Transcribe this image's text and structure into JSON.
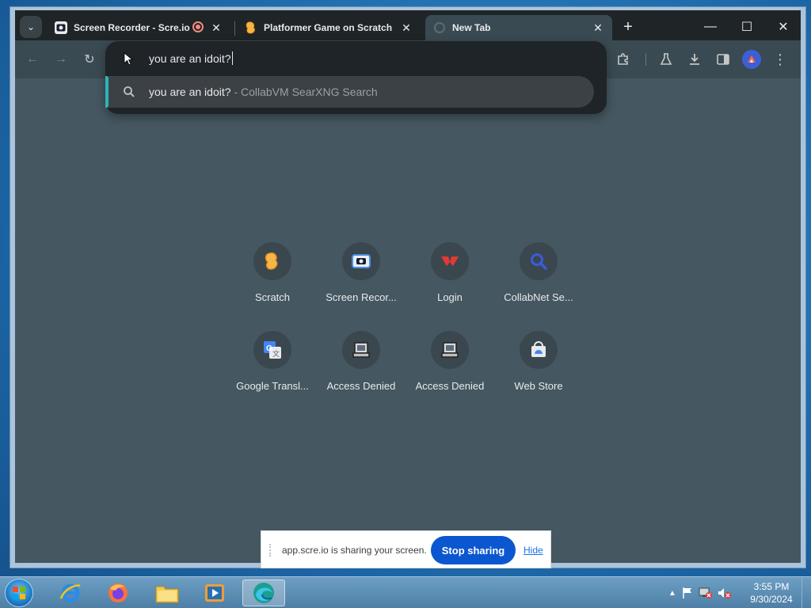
{
  "browser": {
    "tabs": [
      {
        "label": "Screen Recorder - Scre.io",
        "icon": "screen-recorder-icon",
        "recording": true,
        "active": false
      },
      {
        "label": "Platformer Game on Scratch",
        "icon": "scratch-icon",
        "recording": false,
        "active": false
      },
      {
        "label": "New Tab",
        "icon": "new-tab-icon",
        "recording": false,
        "active": true
      }
    ],
    "tab_close_glyph": "✕",
    "new_tab_glyph": "+",
    "window_controls": {
      "minimize": "—",
      "maximize": "☐",
      "close": "✕"
    }
  },
  "toolbar": {
    "back": "←",
    "forward": "→",
    "reload": "↻"
  },
  "omnibox": {
    "query": "you are an idoit?",
    "suggestion": {
      "query": "you are an idoit?",
      "separator": " - ",
      "engine": "CollabVM SearXNG Search"
    }
  },
  "shortcuts": [
    {
      "label": "Scratch",
      "icon": "scratch-icon"
    },
    {
      "label": "Screen Recor...",
      "icon": "screen-recorder-icon"
    },
    {
      "label": "Login",
      "icon": "login-icon"
    },
    {
      "label": "CollabNet Se...",
      "icon": "search-icon"
    },
    {
      "label": "Google Transl...",
      "icon": "google-translate-icon"
    },
    {
      "label": "Access Denied",
      "icon": "access-denied-icon"
    },
    {
      "label": "Access Denied",
      "icon": "access-denied-icon"
    },
    {
      "label": "Web Store",
      "icon": "web-store-icon"
    }
  ],
  "share_bar": {
    "message": "app.scre.io is sharing your screen.",
    "stop_label": "Stop sharing",
    "hide_label": "Hide"
  },
  "taskbar": {
    "apps": [
      "internet-explorer-icon",
      "firefox-icon",
      "file-explorer-icon",
      "media-player-icon",
      "edge-icon"
    ],
    "time": "3:55 PM",
    "date": "9/30/2024"
  },
  "colors": {
    "page_background": "#455760",
    "toolbar": "#3a4a52",
    "omnibox_accent": "#2bb6b8",
    "stop_sharing": "#0b57d0"
  }
}
